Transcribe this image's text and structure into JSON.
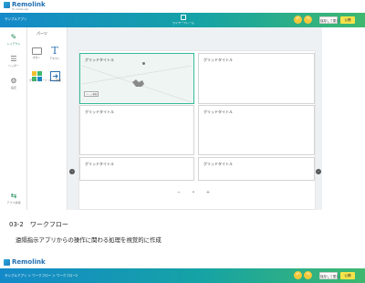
{
  "app": {
    "brand": "Remolink",
    "brand_sub": "for mobile app"
  },
  "header": {
    "left_text": "サンプルアプリ",
    "center_label": "ワイヤーフレーム",
    "undo_icon": "undo-icon",
    "redo_icon": "redo-icon",
    "save_label": "保存して閉じる",
    "publish_label": "公開"
  },
  "sidebar": {
    "items": [
      {
        "label": "レイアウト",
        "icon": "pen-icon",
        "active": true
      },
      {
        "label": "ヘッダー",
        "icon": "header-icon",
        "active": false
      },
      {
        "label": "設定",
        "icon": "settings-icon",
        "active": false
      }
    ],
    "bottom_label": "アプリ情報"
  },
  "parts": {
    "title": "パーツ",
    "items": [
      {
        "label": "ボタン",
        "icon": "button-icon"
      },
      {
        "label": "テキスト",
        "icon": "text-icon"
      },
      {
        "label": "グリッドパーツ",
        "icon": "grid-icon"
      },
      {
        "label": "ページ移動",
        "icon": "page-move-icon"
      }
    ]
  },
  "grid": {
    "cells": [
      {
        "title": "グリッドタイトル",
        "selected": true,
        "badge": "ページ移動"
      },
      {
        "title": "グリッドタイトル",
        "selected": false
      },
      {
        "title": "グリッドタイトル",
        "selected": false
      },
      {
        "title": "グリッドタイトル",
        "selected": false
      },
      {
        "title": "グリッドタイトル",
        "selected": false
      },
      {
        "title": "グリッドタイトル",
        "selected": false
      }
    ]
  },
  "zoom": {
    "minus_icon": "zoom-out-icon",
    "plus_icon": "zoom-in-icon"
  },
  "caption": {
    "heading": "03-2　ワークフロー",
    "body": "遠隔指示アプリからの操作に関わる処理を視覚的に作成"
  },
  "screen2": {
    "breadcrumb": "サンプルアプリ ＞ ワークフロー ＞ ワークフロー2",
    "save_label": "保存して閉じる",
    "publish_label": "公開"
  },
  "colors": {
    "gradient_start": "#1489c9",
    "gradient_end": "#3fb86f",
    "accent_yellow": "#f6e34a",
    "selected_green": "#33b99a"
  }
}
